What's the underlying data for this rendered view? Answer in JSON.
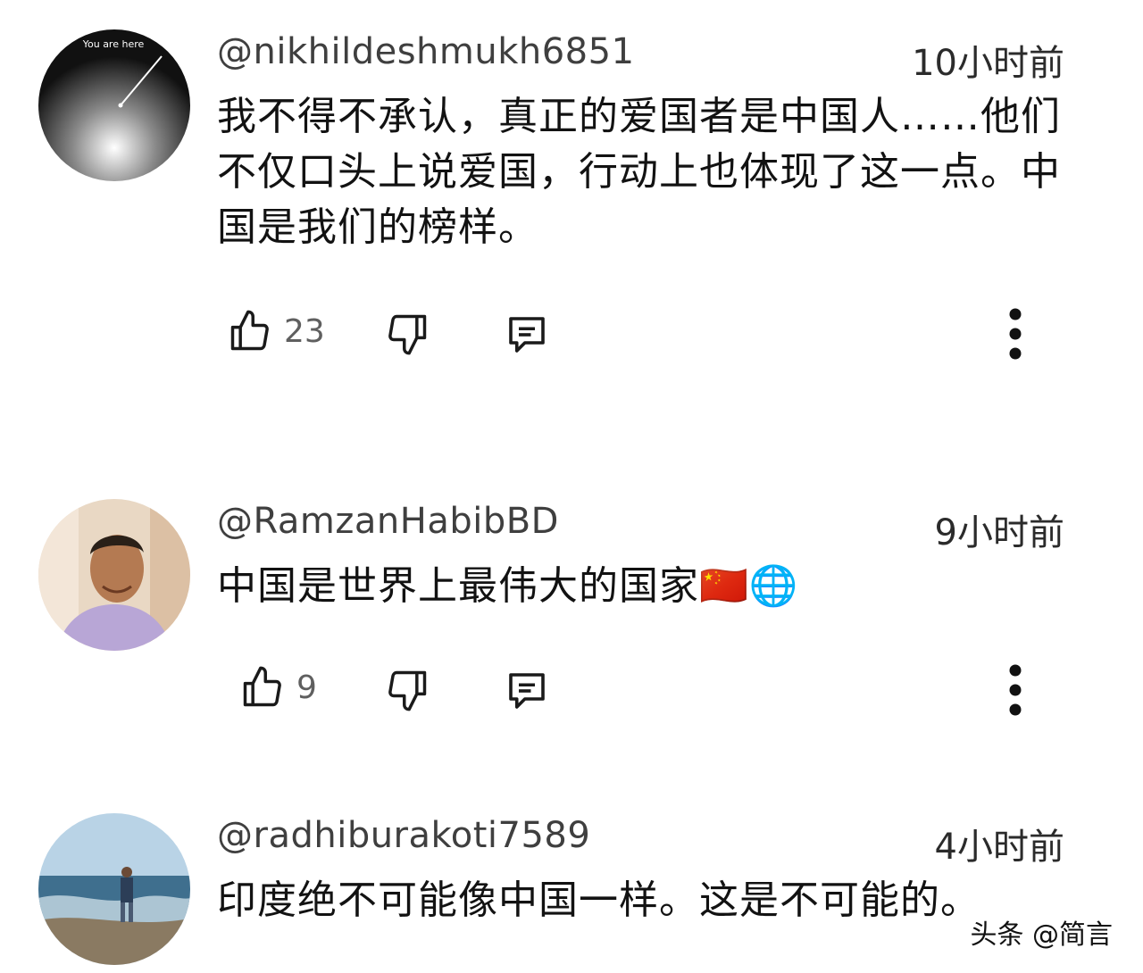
{
  "comments": [
    {
      "username": "@nikhildeshmukh6851",
      "time": "10小时前",
      "text": "我不得不承认，真正的爱国者是中国人……他们不仅口头上说爱国，行动上也体现了这一点。中国是我们的榜样。",
      "likes": "23",
      "avatar_text": "You are here"
    },
    {
      "username": "@RamzanHabibBD",
      "time": "9小时前",
      "text": "中国是世界上最伟大的国家🇨🇳🌐",
      "likes": "9"
    },
    {
      "username": "@radhiburakoti7589",
      "time": "4小时前",
      "text": "印度绝不可能像中国一样。这是不可能的。"
    }
  ],
  "icons": {
    "like": "thumbs-up-icon",
    "dislike": "thumbs-down-icon",
    "reply": "reply-comment-icon",
    "more": "more-vertical-icon"
  },
  "watermark": "头条 @简言",
  "colors": {
    "text": "#0f0f0f",
    "meta": "#5f5f5f",
    "background": "#ffffff"
  }
}
